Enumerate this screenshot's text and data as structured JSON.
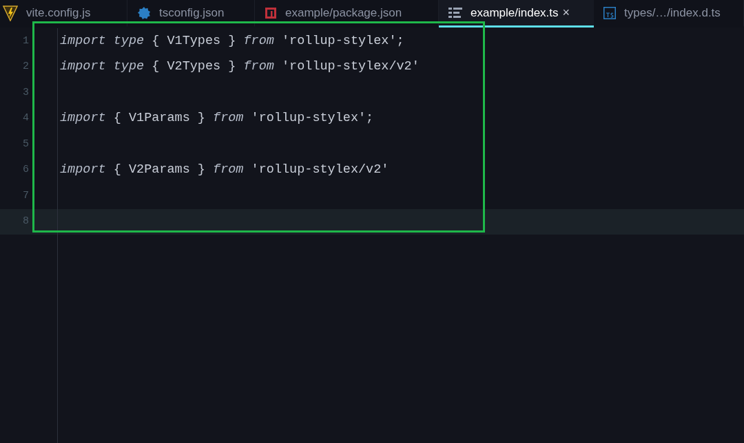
{
  "tabs": [
    {
      "label": "vite.config.js",
      "kind": "vite",
      "selected": false
    },
    {
      "label": "tsconfig.json",
      "kind": "tsconfig",
      "selected": false
    },
    {
      "label": "example/package.json",
      "kind": "npm",
      "selected": false
    },
    {
      "label": "example/index.ts",
      "kind": "list",
      "selected": true,
      "close": "×"
    },
    {
      "label": "types/…/index.d.ts",
      "kind": "ts",
      "selected": false
    }
  ],
  "editor": {
    "lines": [
      {
        "number": "1",
        "current": false,
        "tokens": [
          {
            "text": "import type",
            "kind": "keyword"
          },
          {
            "text": " { V1Types } ",
            "kind": "plain"
          },
          {
            "text": "from",
            "kind": "keyword"
          },
          {
            "text": " 'rollup-stylex';",
            "kind": "plain"
          }
        ]
      },
      {
        "number": "2",
        "current": false,
        "tokens": [
          {
            "text": "import type",
            "kind": "keyword"
          },
          {
            "text": " { V2Types } ",
            "kind": "plain"
          },
          {
            "text": "from",
            "kind": "keyword"
          },
          {
            "text": " 'rollup-stylex/v2'",
            "kind": "plain"
          }
        ]
      },
      {
        "number": "3",
        "current": false
      },
      {
        "number": "4",
        "current": false,
        "tokens": [
          {
            "text": "import",
            "kind": "keyword"
          },
          {
            "text": " { V1Params } ",
            "kind": "plain"
          },
          {
            "text": "from",
            "kind": "keyword"
          },
          {
            "text": " 'rollup-stylex';",
            "kind": "plain"
          }
        ]
      },
      {
        "number": "5",
        "current": false
      },
      {
        "number": "6",
        "current": false,
        "tokens": [
          {
            "text": "import",
            "kind": "keyword"
          },
          {
            "text": " { V2Params } ",
            "kind": "plain"
          },
          {
            "text": "from",
            "kind": "keyword"
          },
          {
            "text": " 'rollup-stylex/v2'",
            "kind": "plain"
          }
        ]
      },
      {
        "number": "7",
        "current": false
      },
      {
        "number": "8",
        "current": true
      }
    ]
  }
}
